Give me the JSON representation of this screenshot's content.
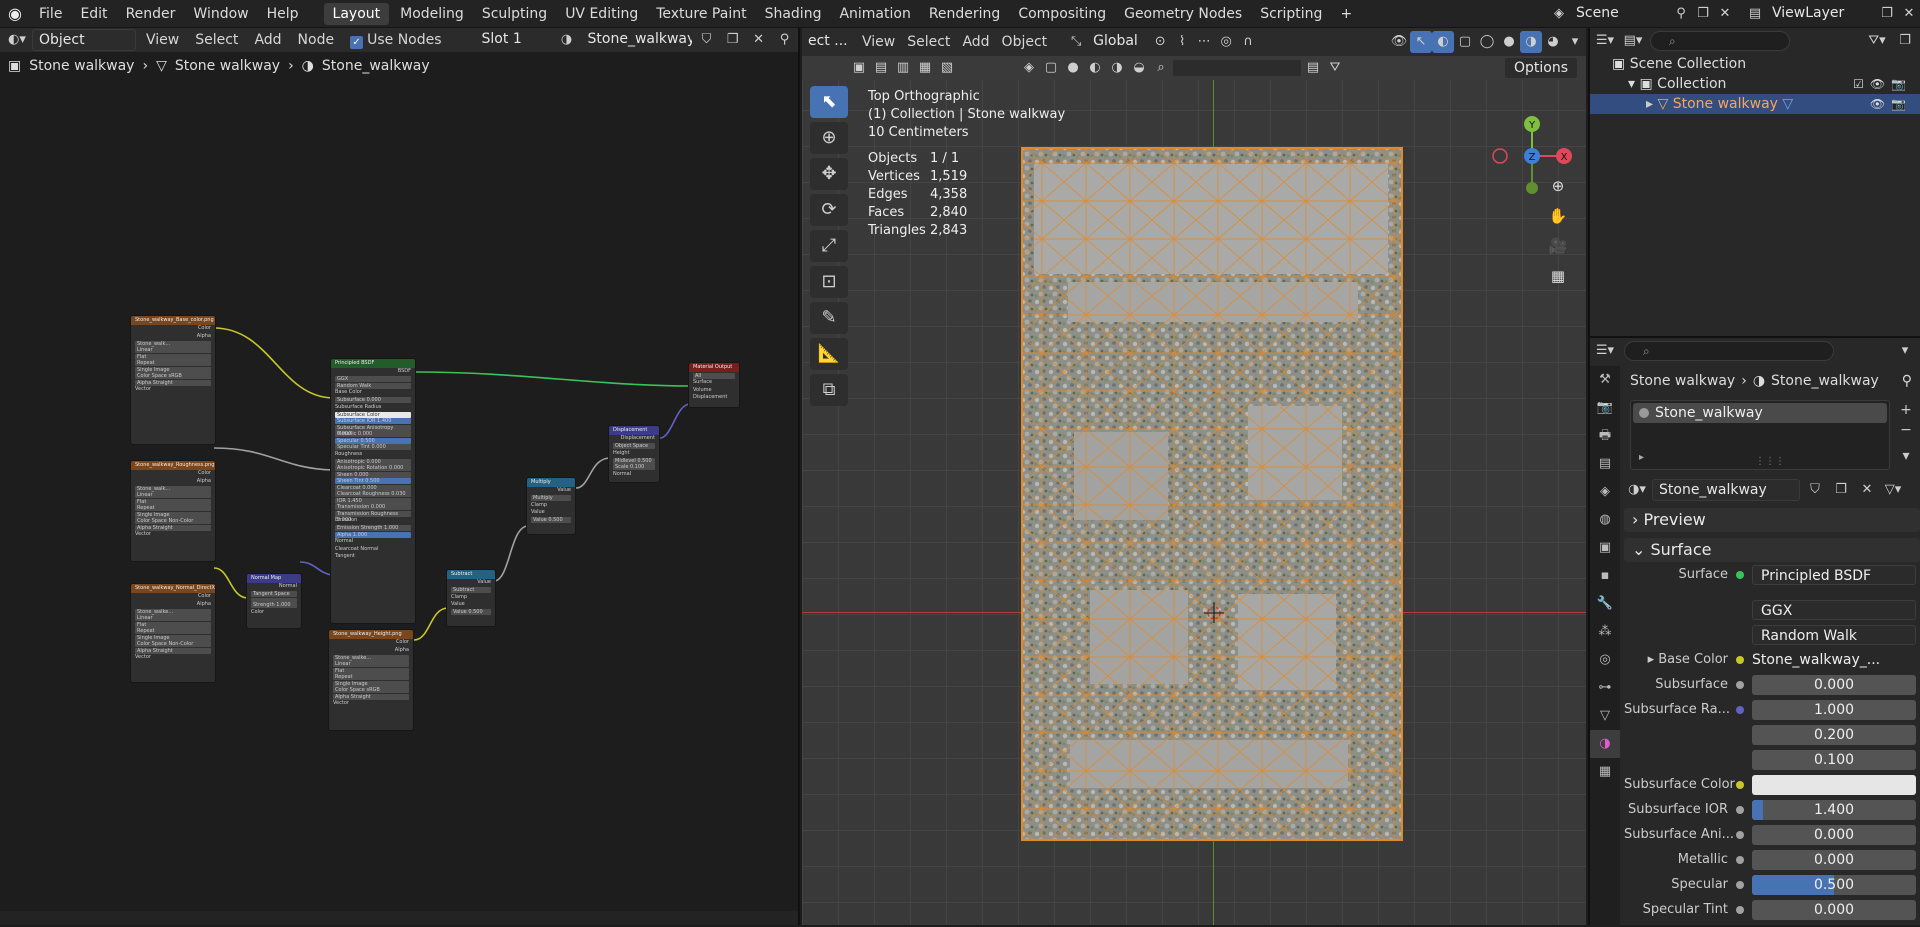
{
  "topbar": {
    "menus": [
      "File",
      "Edit",
      "Render",
      "Window",
      "Help"
    ],
    "workspaces": [
      "Layout",
      "Modeling",
      "Sculpting",
      "UV Editing",
      "Texture Paint",
      "Shading",
      "Animation",
      "Rendering",
      "Compositing",
      "Geometry Nodes",
      "Scripting"
    ],
    "active_workspace": "Layout",
    "scene": "Scene",
    "view_layer": "ViewLayer"
  },
  "node_editor": {
    "header": {
      "mode": "Object",
      "view": "View",
      "select": "Select",
      "add": "Add",
      "node": "Node",
      "use_nodes": "Use Nodes",
      "slot": "Slot 1",
      "material": "Stone_walkway"
    },
    "breadcrumb": [
      "Stone walkway",
      "Stone walkway",
      "Stone_walkway"
    ],
    "nodes": [
      {
        "title": "Stone_walkway_Base_color.png",
        "rows": [
          "Stone_walk...",
          "Linear",
          "Flat",
          "Repeat",
          "Single Image",
          "Color Space   sRGB",
          "Alpha   Straight",
          "Vector"
        ],
        "outputs": [
          "Color",
          "Alpha"
        ]
      },
      {
        "title": "Stone_walkway_Roughness.png",
        "rows": [
          "Stone_walk...",
          "Linear",
          "Flat",
          "Repeat",
          "Single Image",
          "Color Space   Non-Color",
          "Alpha   Straight",
          "Vector"
        ],
        "outputs": [
          "Color",
          "Alpha"
        ]
      },
      {
        "title": "Stone_walkway_Normal_DirectX.png",
        "rows": [
          "Stone_walke...",
          "Linear",
          "Flat",
          "Repeat",
          "Single Image",
          "Color Space   Non-Color",
          "Alpha   Straight",
          "Vector"
        ],
        "outputs": [
          "Color",
          "Alpha"
        ]
      },
      {
        "title": "Normal Map",
        "rows": [
          "Tangent Space",
          "Strength  1.000",
          "Color"
        ],
        "outputs": [
          "Normal"
        ]
      },
      {
        "title": "Principled BSDF",
        "rows": [
          "GGX",
          "Random Walk",
          "Base Color",
          "Subsurface  0.000",
          "Subsurface Radius",
          "Subsurface Color",
          "Subsurface IOR  1.400",
          "Subsurface Anisotropy  0.000",
          "Metallic  0.000",
          "Specular  0.500",
          "Specular Tint  0.000",
          "Roughness",
          "Anisotropic  0.000",
          "Anisotropic Rotation  0.000",
          "Sheen  0.000",
          "Sheen Tint  0.500",
          "Clearcoat  0.000",
          "Clearcoat Roughness  0.030",
          "IOR  1.450",
          "Transmission  0.000",
          "Transmission Roughness  0.000",
          "Emission",
          "Emission Strength  1.000",
          "Alpha  1.000",
          "Normal",
          "Clearcoat Normal",
          "Tangent"
        ],
        "outputs": [
          "BSDF"
        ]
      },
      {
        "title": "Stone_walkway_Height.png",
        "rows": [
          "Stone_walke...",
          "Linear",
          "Flat",
          "Repeat",
          "Single Image",
          "Color Space   sRGB",
          "Alpha   Straight",
          "Vector"
        ],
        "outputs": [
          "Color",
          "Alpha"
        ]
      },
      {
        "title": "Subtract",
        "rows": [
          "Subtract",
          "Clamp",
          "Value",
          "Value  0.500"
        ],
        "outputs": [
          "Value"
        ]
      },
      {
        "title": "Multiply",
        "rows": [
          "Multiply",
          "Clamp",
          "Value",
          "Value  0.500"
        ],
        "outputs": [
          "Value"
        ]
      },
      {
        "title": "Displacement",
        "rows": [
          "Object Space",
          "Height",
          "Midlevel  0.500",
          "Scale  0.100",
          "Normal"
        ],
        "outputs": [
          "Displacement"
        ]
      },
      {
        "title": "Material Output",
        "rows": [
          "All",
          "Surface",
          "Volume",
          "Displacement"
        ],
        "outputs": []
      }
    ]
  },
  "viewport": {
    "header": {
      "mode": "ect ...",
      "view": "View",
      "select": "Select",
      "add": "Add",
      "object": "Object",
      "orientation": "Global",
      "options": "Options"
    },
    "overlay_lines": [
      "Top Orthographic",
      "(1) Collection | Stone walkway",
      "10 Centimeters"
    ],
    "stats": [
      {
        "label": "Objects",
        "value": "1 / 1"
      },
      {
        "label": "Vertices",
        "value": "1,519"
      },
      {
        "label": "Edges",
        "value": "4,358"
      },
      {
        "label": "Faces",
        "value": "2,840"
      },
      {
        "label": "Triangles",
        "value": "2,843"
      }
    ],
    "gizmo": {
      "x": "X",
      "y": "Y",
      "z": "Z"
    }
  },
  "outliner": {
    "rows": [
      "Scene Collection",
      "Collection",
      "Stone walkway"
    ]
  },
  "properties": {
    "breadcrumb": [
      "Stone walkway",
      "Stone_walkway"
    ],
    "slot": "Stone_walkway",
    "material_name": "Stone_walkway",
    "panels": {
      "preview": "Preview",
      "surface": "Surface"
    },
    "surface": {
      "surface_label": "Surface",
      "surface_value": "Principled BSDF",
      "distribution": "GGX",
      "subsurface_method": "Random Walk",
      "rows": [
        {
          "label": "Base Color",
          "value": "Stone_walkway_...",
          "dot": "yellow",
          "kind": "link"
        },
        {
          "label": "Subsurface",
          "value": "0.000",
          "dot": "grey",
          "kind": "num"
        },
        {
          "label": "Subsurface Ra...",
          "value": "1.000",
          "dot": "violet",
          "kind": "num"
        },
        {
          "label": "",
          "value": "0.200",
          "dot": "",
          "kind": "num"
        },
        {
          "label": "",
          "value": "0.100",
          "dot": "",
          "kind": "num"
        },
        {
          "label": "Subsurface Color",
          "value": "",
          "dot": "yellow",
          "kind": "color"
        },
        {
          "label": "Subsurface IOR",
          "value": "1.400",
          "dot": "grey",
          "kind": "num",
          "fill": 0.07
        },
        {
          "label": "Subsurface Ani...",
          "value": "0.000",
          "dot": "grey",
          "kind": "num"
        },
        {
          "label": "Metallic",
          "value": "0.000",
          "dot": "grey",
          "kind": "num"
        },
        {
          "label": "Specular",
          "value": "0.500",
          "dot": "grey",
          "kind": "num",
          "fill": 0.5
        },
        {
          "label": "Specular Tint",
          "value": "0.000",
          "dot": "grey",
          "kind": "num"
        }
      ]
    }
  },
  "colors": {
    "accent": "#4772b3",
    "selection_orange": "#f5a65a",
    "mesh_wire": "#e08a2c"
  }
}
